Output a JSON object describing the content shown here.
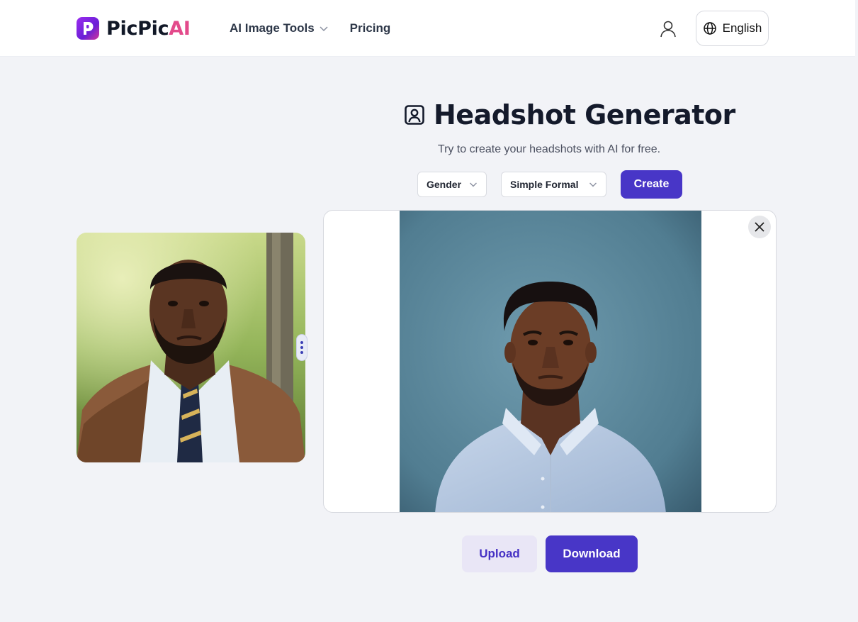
{
  "header": {
    "logo_primary": "PicPic",
    "logo_accent": "AI",
    "nav": [
      {
        "label": "AI Image Tools",
        "has_dropdown": true
      },
      {
        "label": "Pricing",
        "has_dropdown": false
      }
    ],
    "language_label": "English"
  },
  "tool": {
    "title": "Headshot Generator",
    "subtitle": "Try to create your headshots with AI for free.",
    "gender_select": "Gender",
    "style_select": "Simple Formal",
    "create_label": "Create"
  },
  "actions": {
    "upload_label": "Upload",
    "download_label": "Download"
  },
  "icons": {
    "title_icon": "portrait-icon",
    "user_icon": "user-icon",
    "globe_icon": "globe-icon",
    "close_icon": "close-icon",
    "chevron": "chevron-down-icon"
  },
  "colors": {
    "brand": "#4836c7",
    "brand_light": "#e9e6f6",
    "logo_accent": "#e34a8b",
    "page_bg": "#f2f3f7"
  }
}
